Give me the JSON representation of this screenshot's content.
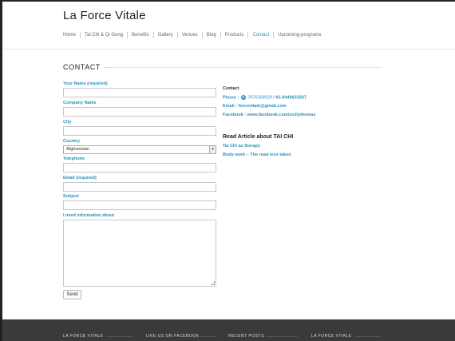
{
  "site": {
    "title": "La Force Vitale"
  },
  "nav": {
    "items": [
      "Home",
      "Tai Chi & Qi Gong",
      "Benefits",
      "Gallery",
      "Venues",
      "Blog",
      "Products",
      "Contact",
      "Upcoming-programs"
    ],
    "active": "Contact"
  },
  "page": {
    "title": "CONTACT"
  },
  "form": {
    "name_label": "Your Name (required)",
    "company_label": "Company Name",
    "city_label": "City",
    "country_label": "Country",
    "country_value": "Afghanistan",
    "telephone_label": "Telephone",
    "email_label": "Email (required)",
    "subject_label": "Subject",
    "info_label": "I need information about",
    "send_label": "Send"
  },
  "contact": {
    "heading": "Contact",
    "phone_label": "Phone :",
    "phone1": "7676269929",
    "phone_sep": "/",
    "phone2": "91-9449633267",
    "email_line": "Email : forcevitale@gmail.com",
    "facebook_line": "Facebook : www.facebook.com/cicilythomas"
  },
  "articles": {
    "heading": "Read Article about TAI CHI",
    "links": [
      "Tai Chi as therapy",
      "Body work – The road less taken"
    ]
  },
  "footer": {
    "columns": [
      "LA FORCE VITALE",
      "LIKE US ON FACEBOOK",
      "RECENT POSTS",
      "LA FORCE VITALE"
    ]
  },
  "colors": {
    "accent": "#2a8fbd",
    "footer_bg": "#3a3a3a"
  },
  "icons": {
    "phone": "skype-icon",
    "select_arrow": "chevron-down-icon"
  }
}
